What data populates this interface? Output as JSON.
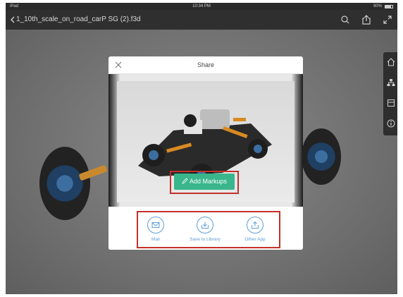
{
  "status_bar": {
    "device": "iPad",
    "time": "10:34 PM",
    "battery": "90%"
  },
  "nav": {
    "title": "1_10th_scale_on_road_carP SG (2).f3d"
  },
  "dialog": {
    "title": "Share",
    "add_markups_label": "Add Markups",
    "actions": [
      {
        "label": "Mail",
        "icon": "mail-icon"
      },
      {
        "label": "Save to Library",
        "icon": "download-icon"
      },
      {
        "label": "Other App",
        "icon": "upload-icon"
      }
    ]
  },
  "colors": {
    "accent_green": "#39b68b",
    "highlight_red": "#c4302b",
    "action_blue": "#5d9ed6"
  }
}
